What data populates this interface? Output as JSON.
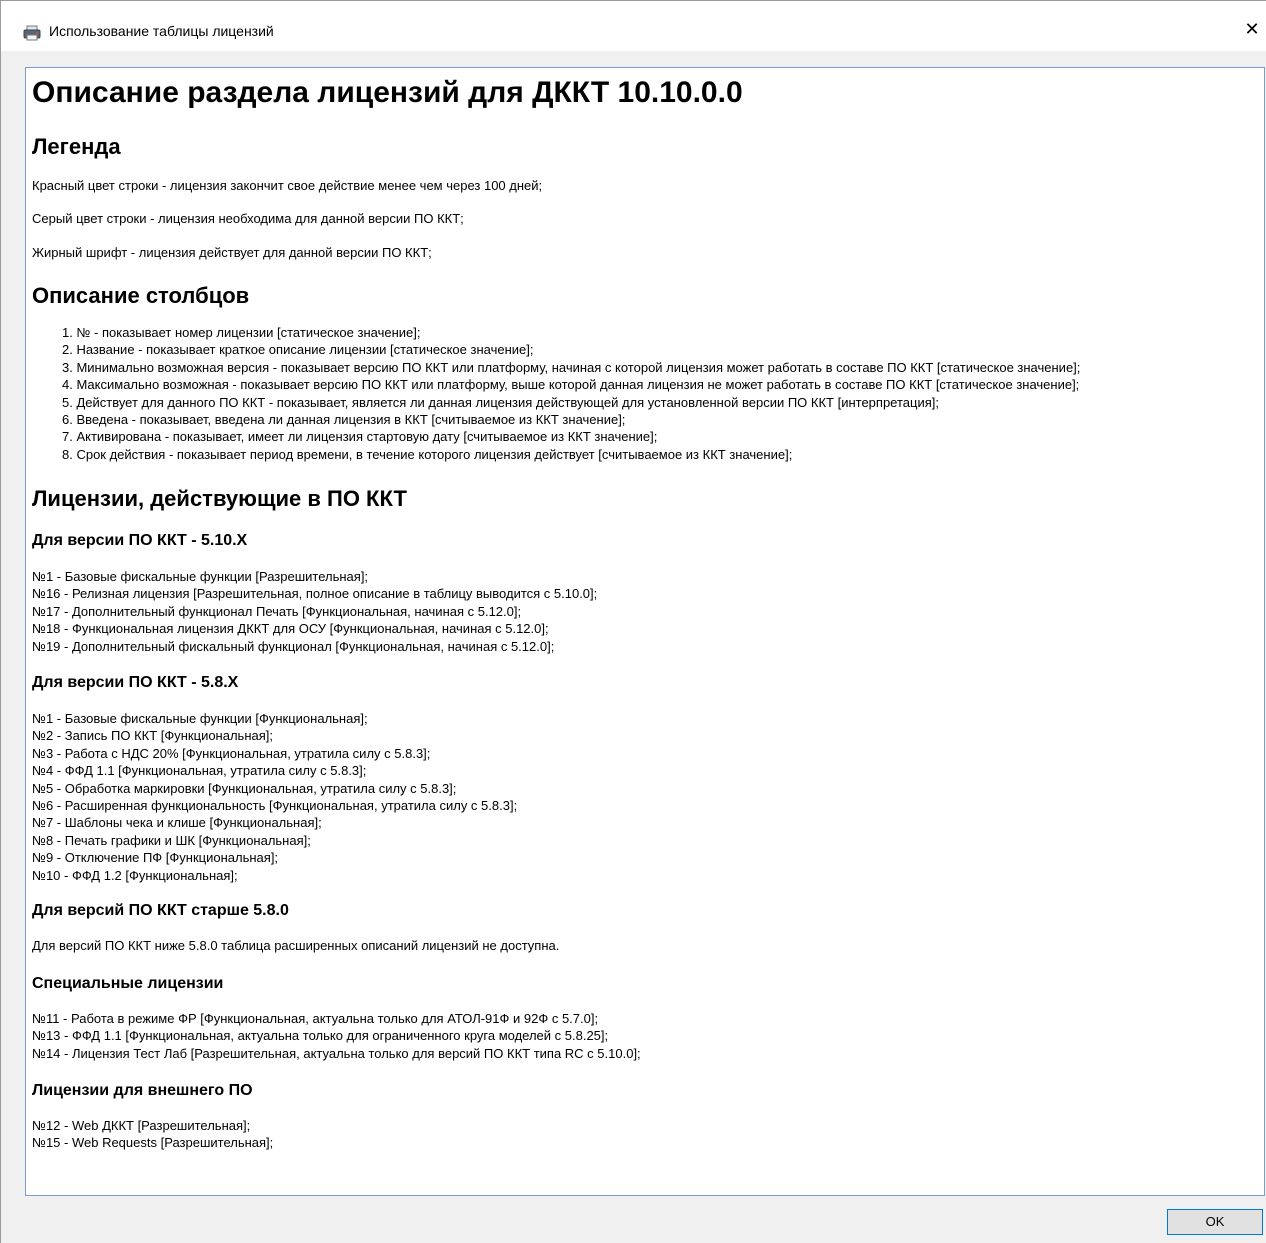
{
  "window": {
    "title": "Использование таблицы лицензий",
    "close_label": "✕"
  },
  "doc": {
    "title": "Описание раздела лицензий для ДККТ 10.10.0.0",
    "legend": {
      "heading": "Легенда",
      "lines": [
        "Красный цвет строки - лицензия закончит свое действие менее чем через 100 дней;",
        "Серый цвет строки - лицензия необходима для данной версии ПО ККТ;",
        "Жирный шрифт - лицензия действует для данной версии ПО ККТ;"
      ]
    },
    "columns": {
      "heading": "Описание столбцов",
      "items": [
        "1. №  - показывает номер лицензии [статическое значение];",
        "2. Название - показывает краткое описание лицензии [статическое значение];",
        "3. Минимально возможная версия - показывает версию ПО ККТ или платформу, начиная с которой лицензия может работать в составе ПО ККТ [статическое значение];",
        "4. Максимально возможная - показывает версию ПО ККТ или платформу, выше которой данная лицензия не может работать в составе ПО ККТ [статическое значение];",
        "5. Действует для данного ПО ККТ - показывает, является ли данная лицензия действующей для установленной версии ПО ККТ [интерпретация];",
        "6. Введена - показывает, введена ли данная лицензия в ККТ [считываемое из ККТ значение];",
        "7. Активирована - показывает, имеет ли лицензия стартовую дату [считываемое из ККТ значение];",
        "8. Срок действия - показывает период времени, в течение которого лицензия действует [считываемое из ККТ значение];"
      ]
    },
    "licenses_heading": "Лицензии, действующие в ПО ККТ",
    "v510": {
      "heading": "Для версии ПО ККТ - 5.10.X",
      "items": [
        "№1 - Базовые фискальные функции [Разрешительная];",
        "№16 - Релизная лицензия [Разрешительная, полное описание в таблицу выводится с 5.10.0];",
        "№17 - Дополнительный функционал Печать [Функциональная, начиная с 5.12.0];",
        "№18 - Функциональная лицензия ДККТ для ОСУ [Функциональная, начиная с 5.12.0];",
        "№19 - Дополнительный фискальный функционал [Функциональная, начиная с 5.12.0];"
      ]
    },
    "v58": {
      "heading": "Для версии ПО ККТ - 5.8.X",
      "items": [
        "№1 - Базовые фискальные функции [Функциональная];",
        "№2 - Запись ПО ККТ [Функциональная];",
        "№3 - Работа с НДС 20% [Функциональная, утратила силу с 5.8.3];",
        "№4 - ФФД 1.1 [Функциональная, утратила силу с 5.8.3];",
        "№5 - Обработка маркировки [Функциональная, утратила силу с 5.8.3];",
        "№6 - Расширенная функциональность [Функциональная, утратила силу с 5.8.3];",
        "№7 - Шаблоны чека и клише [Функциональная];",
        "№8 - Печать графики и ШК [Функциональная];",
        "№9 - Отключение ПФ [Функциональная];",
        "№10 - ФФД 1.2 [Функциональная];"
      ]
    },
    "older": {
      "heading": "Для версий ПО ККТ старше 5.8.0",
      "text": "Для версий ПО ККТ ниже 5.8.0 таблица расширенных описаний лицензий не доступна."
    },
    "special": {
      "heading": "Специальные лицензии",
      "items": [
        "№11 - Работа в режиме ФР [Функциональная, актуальна только для АТОЛ-91Ф и 92Ф с 5.7.0];",
        "№13 - ФФД 1.1 [Функциональная, актуальна только для ограниченного круга моделей с 5.8.25];",
        "№14 - Лицензия Тест Лаб [Разрешительная, актуальна только для версий ПО ККТ типа RC с 5.10.0];"
      ]
    },
    "external": {
      "heading": "Лицензии для внешнего ПО",
      "items": [
        "№12 - Web ДККТ [Разрешительная];",
        "№15 - Web Requests [Разрешительная];"
      ]
    }
  },
  "buttons": {
    "ok": "OK"
  },
  "colors": {
    "accent_border": "#0078d7",
    "content_border": "#7a9ecf"
  }
}
